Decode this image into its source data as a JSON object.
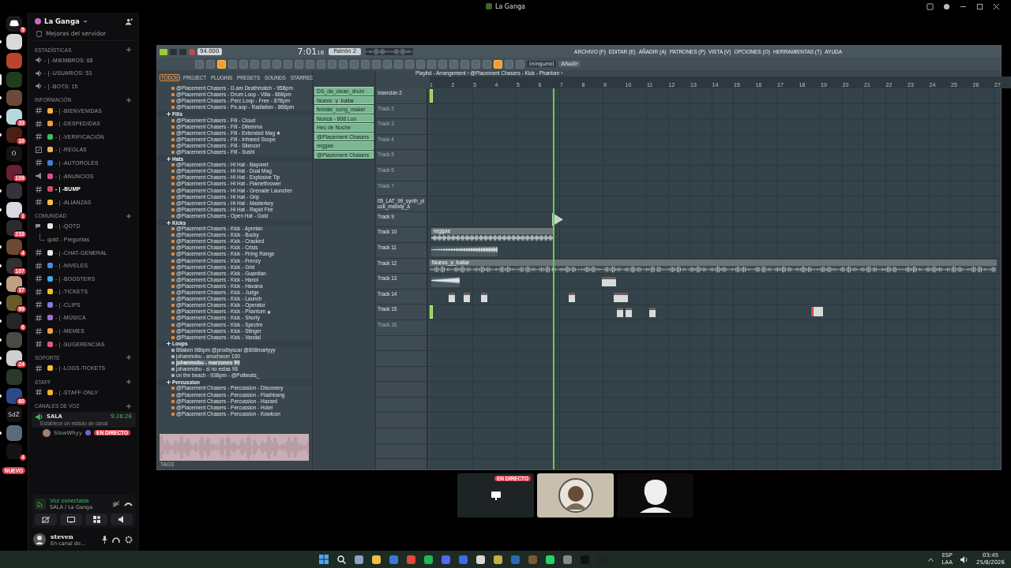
{
  "window": {
    "title": "La Ganga"
  },
  "servers": [
    {
      "kind": "home",
      "badge": "5",
      "selected": false,
      "unread": false
    },
    {
      "kind": "server",
      "color": "#d9d9d9",
      "selected": false,
      "unread": true
    },
    {
      "kind": "server",
      "color": "#b8442c",
      "selected": false,
      "unread": false
    },
    {
      "kind": "server",
      "color": "#1f3d1c",
      "selected": true,
      "unread": false
    },
    {
      "kind": "server",
      "color": "#6b4a3a",
      "selected": false,
      "unread": true
    },
    {
      "kind": "server",
      "color": "#b8d8e0",
      "badge": "33",
      "selected": false,
      "unread": true
    },
    {
      "kind": "server",
      "color": "#4a1f14",
      "badge": "10",
      "selected": false,
      "unread": true
    },
    {
      "kind": "text",
      "label": "O",
      "selected": false,
      "unread": false
    },
    {
      "kind": "server",
      "color": "#6a1f33",
      "badge": "109",
      "selected": false,
      "unread": false
    },
    {
      "kind": "server",
      "color": "#333338",
      "selected": false,
      "unread": true
    },
    {
      "kind": "server",
      "color": "#d8d8e0",
      "badge": "1",
      "selected": false,
      "unread": true
    },
    {
      "kind": "server",
      "color": "#2c2c2c",
      "badge": "233",
      "selected": false,
      "unread": false
    },
    {
      "kind": "server",
      "color": "#6a4a32",
      "badge": "4",
      "selected": false,
      "unread": true
    },
    {
      "kind": "server",
      "color": "#303030",
      "badge": "107",
      "selected": false,
      "unread": true
    },
    {
      "kind": "server",
      "color": "#c0a080",
      "badge": "37",
      "selected": false,
      "unread": true
    },
    {
      "kind": "server",
      "color": "#6a5a2a",
      "badge": "99",
      "selected": false,
      "unread": true
    },
    {
      "kind": "server",
      "color": "#262626",
      "badge": "6",
      "selected": false,
      "unread": true
    },
    {
      "kind": "server",
      "color": "#4a4a44",
      "selected": false,
      "unread": true
    },
    {
      "kind": "server",
      "color": "#cfcfcf",
      "badge": "24",
      "selected": false,
      "unread": true
    },
    {
      "kind": "server",
      "color": "#2a3a2a",
      "selected": false,
      "unread": false
    },
    {
      "kind": "server",
      "color": "#2a4a8a",
      "badge": "60",
      "selected": false,
      "unread": true
    },
    {
      "kind": "text",
      "label": "SdZ",
      "selected": false,
      "unread": false
    },
    {
      "kind": "server",
      "color": "#5a6a7a",
      "selected": false,
      "unread": true
    },
    {
      "kind": "server",
      "color": "#141414",
      "badge": "4",
      "selected": false,
      "unread": false
    },
    {
      "kind": "new",
      "label": "NUEVO",
      "selected": false,
      "unread": false
    }
  ],
  "server_header": {
    "name": "La Ganga",
    "boosts": "Mejoras del servidor"
  },
  "categories": [
    {
      "name": "ESTADÍSTICAS",
      "channels": [
        {
          "kind": "voice",
          "name": "- | -MIEMBROS: 68",
          "unread": false
        },
        {
          "kind": "voice",
          "name": "- | -USUARIOS: 53",
          "unread": false
        },
        {
          "kind": "voice",
          "name": "- | -BOTS: 15",
          "unread": false
        }
      ]
    },
    {
      "name": "INFORMACIÓN",
      "channels": [
        {
          "kind": "text",
          "color": "#f2b23a",
          "name": "- | -BIENVENIDAS",
          "unread": false
        },
        {
          "kind": "text",
          "color": "#f29a3a",
          "name": "- | -DESPEDIDAS",
          "unread": false
        },
        {
          "kind": "text",
          "color": "#3fbf5a",
          "name": "- | -VERIFICACIÓN",
          "unread": false
        },
        {
          "kind": "rules",
          "color": "#e8b060",
          "name": "- | -REGLAS",
          "unread": false
        },
        {
          "kind": "text",
          "color": "#4a7ad8",
          "name": "- | -AUTOROLES",
          "unread": false
        },
        {
          "kind": "announce",
          "color": "#e0508a",
          "name": "- | -ANUNCIOS",
          "unread": false
        },
        {
          "kind": "text",
          "color": "#d0506a",
          "name": "- | -BUMP",
          "unread": true
        },
        {
          "kind": "text",
          "color": "#f2c040",
          "name": "- | -ALIANZAS",
          "unread": false
        }
      ]
    },
    {
      "name": "COMUNIDAD",
      "channels": [
        {
          "kind": "forum",
          "color": "#e8e8e8",
          "name": "- | -QOTD",
          "unread": false
        },
        {
          "kind": "thread",
          "name": "qotd - Preguntas",
          "unread": false
        },
        {
          "kind": "text",
          "color": "#e8e8e8",
          "name": "- | -CHAT-GENERAL",
          "unread": false
        },
        {
          "kind": "text",
          "color": "#4a8ae0",
          "name": "- | -NIVELES",
          "unread": false
        },
        {
          "kind": "text",
          "color": "#40a8e8",
          "name": "- | -BOOSTERS",
          "unread": false
        },
        {
          "kind": "text",
          "color": "#f0c030",
          "name": "- | -TICKETS",
          "unread": false
        },
        {
          "kind": "text",
          "color": "#8a7ad0",
          "name": "- | -CLIPS",
          "unread": false
        },
        {
          "kind": "text",
          "color": "#9a70d8",
          "name": "- | -MÚSICA",
          "unread": false
        },
        {
          "kind": "text",
          "color": "#f0a040",
          "name": "- | -MEMES",
          "unread": false
        },
        {
          "kind": "text",
          "color": "#e05a7a",
          "name": "- | -SUGERENCIAS",
          "unread": false
        }
      ]
    },
    {
      "name": "SOPORTE",
      "channels": [
        {
          "kind": "text",
          "color": "#f0c040",
          "name": "- | -LOGS-TICKETS",
          "unread": false
        }
      ]
    },
    {
      "name": "STAFF",
      "channels": [
        {
          "kind": "text",
          "color": "#f0b030",
          "name": "- | -STAFF-ONLY",
          "unread": false
        }
      ]
    },
    {
      "name": "CANALES DE VOZ"
    }
  ],
  "voice_channel": {
    "name": "SALA",
    "timer": "9:28:26",
    "status_placeholder": "Establece un estado de canal",
    "member": "SlowWhyy",
    "live": "EN DIRECTO"
  },
  "voice_panel": {
    "status": "Voz conectada",
    "channel": "SALA / La Ganga"
  },
  "user_panel": {
    "name": "steven",
    "status": "En canal de..."
  },
  "fl": {
    "tempo": "94.000",
    "time": "7:01",
    "time_small": "18",
    "pattern": "Patrón 2",
    "menu": [
      "ARCHIVO (F)",
      "EDITAR (E)",
      "AÑADIR (A)",
      "PATRONES (P)",
      "VISTA (V)",
      "OPCIONES (O)",
      "HERRAMIENTAS (T)",
      "AYUDA"
    ],
    "tools": [
      {
        "selected": false
      },
      {
        "selected": false
      },
      {
        "selected": true
      },
      {
        "selected": false
      },
      {
        "selected": false
      },
      {
        "selected": false
      },
      {
        "selected": false
      },
      {
        "selected": false
      },
      {
        "selected": false
      },
      {
        "selected": false
      },
      {
        "selected": false
      },
      {
        "selected": false
      },
      {
        "selected": false
      },
      {
        "selected": false
      },
      {
        "selected": false
      },
      {
        "selected": false
      },
      {
        "selected": false
      },
      {
        "selected": false
      },
      {
        "selected": false
      },
      {
        "selected": false
      },
      {
        "selected": false
      },
      {
        "selected": false
      },
      {
        "selected": false
      },
      {
        "selected": false
      },
      {
        "selected": false
      },
      {
        "selected": false
      },
      {
        "selected": false
      },
      {
        "selected": true
      },
      {
        "selected": false
      },
      {
        "selected": false
      }
    ],
    "snap": "(ninguno)",
    "add": "Añadir",
    "browser_tabs": [
      {
        "label": "TODOS",
        "selected": true
      },
      {
        "label": "PROJECT",
        "selected": false
      },
      {
        "label": "PLUGINS",
        "selected": false
      },
      {
        "label": "PRESETS",
        "selected": false
      },
      {
        "label": "SOUNDS",
        "selected": false
      },
      {
        "label": "STARRED",
        "selected": false
      }
    ],
    "browser": [
      {
        "kind": "sample",
        "label": "@Placement Chasers - D.am Deathmatch - 95Bpm",
        "starred": false,
        "selected": false
      },
      {
        "kind": "sample",
        "label": "@Placement Chasers - Drum Loop - Villa - 86Bpm",
        "starred": false,
        "selected": false
      },
      {
        "kind": "sample",
        "label": "@Placement Chasers - Perc Loop - Free - 87Bpm",
        "starred": false,
        "selected": false
      },
      {
        "kind": "sample",
        "label": "@Placement Chasers - Pe.aop - Radiation - 86Bpm",
        "starred": false,
        "selected": false
      },
      {
        "kind": "folder",
        "label": "Fills",
        "children": [
          {
            "kind": "sample",
            "label": "@Placement Chasers - Fill - Cloud",
            "starred": false,
            "selected": false
          },
          {
            "kind": "sample",
            "label": "@Placement Chasers - Fill - Dilemma",
            "starred": false,
            "selected": false
          },
          {
            "kind": "sample",
            "label": "@Placement Chasers - Fill - Extended Mag",
            "starred": true,
            "selected": false
          },
          {
            "kind": "sample",
            "label": "@Placement Chasers - Fill - Infrared Scope",
            "starred": false,
            "selected": false
          },
          {
            "kind": "sample",
            "label": "@Placement Chasers - Fill - Silencer",
            "starred": false,
            "selected": false
          },
          {
            "kind": "sample",
            "label": "@Placement Chasers - Fill - Sushi",
            "starred": false,
            "selected": false
          }
        ]
      },
      {
        "kind": "folder",
        "label": "Hats",
        "children": [
          {
            "kind": "sample",
            "label": "@Placement Chasers - Hi Hat - Bayonet",
            "starred": false,
            "selected": false
          },
          {
            "kind": "sample",
            "label": "@Placement Chasers - Hi Hat - Dual Mag",
            "starred": false,
            "selected": false
          },
          {
            "kind": "sample",
            "label": "@Placement Chasers - Hi Hat - Explosive Tip",
            "starred": false,
            "selected": false
          },
          {
            "kind": "sample",
            "label": "@Placement Chasers - Hi Hat - Flamethrower",
            "starred": false,
            "selected": false
          },
          {
            "kind": "sample",
            "label": "@Placement Chasers - Hi Hat - Grenade Launcher",
            "starred": false,
            "selected": false
          },
          {
            "kind": "sample",
            "label": "@Placement Chasers - Hi Hat - Grip",
            "starred": false,
            "selected": false
          },
          {
            "kind": "sample",
            "label": "@Placement Chasers - Hi Hat - Masterkey",
            "starred": false,
            "selected": false
          },
          {
            "kind": "sample",
            "label": "@Placement Chasers - Hi Hat - Rapid Fire",
            "starred": false,
            "selected": false
          },
          {
            "kind": "sample",
            "label": "@Placement Chasers - Open Hat - Gold",
            "starred": false,
            "selected": false
          }
        ]
      },
      {
        "kind": "folder",
        "label": "Kicks",
        "children": [
          {
            "kind": "sample",
            "label": "@Placement Chasers - Kick - Apretan",
            "starred": false,
            "selected": false
          },
          {
            "kind": "sample",
            "label": "@Placement Chasers - Kick - Bucky",
            "starred": false,
            "selected": false
          },
          {
            "kind": "sample",
            "label": "@Placement Chasers - Kick - Cracked",
            "starred": false,
            "selected": false
          },
          {
            "kind": "sample",
            "label": "@Placement Chasers - Kick - Crisis",
            "starred": false,
            "selected": false
          },
          {
            "kind": "sample",
            "label": "@Placement Chasers - Kick - Firing Range",
            "starred": false,
            "selected": false
          },
          {
            "kind": "sample",
            "label": "@Placement Chasers - Kick - Frenzy",
            "starred": false,
            "selected": false
          },
          {
            "kind": "sample",
            "label": "@Placement Chasers - Kick - Grid",
            "starred": false,
            "selected": false
          },
          {
            "kind": "sample",
            "label": "@Placement Chasers - Kick - Guardian",
            "starred": false,
            "selected": false
          },
          {
            "kind": "sample",
            "label": "@Placement Chasers - Kick - Hanoi",
            "starred": false,
            "selected": false
          },
          {
            "kind": "sample",
            "label": "@Placement Chasers - Kick - Havana",
            "starred": false,
            "selected": false
          },
          {
            "kind": "sample",
            "label": "@Placement Chasers - Kick - Judge",
            "starred": false,
            "selected": false
          },
          {
            "kind": "sample",
            "label": "@Placement Chasers - Kick - Launch",
            "starred": false,
            "selected": false
          },
          {
            "kind": "sample",
            "label": "@Placement Chasers - Kick - Operator",
            "starred": false,
            "selected": false
          },
          {
            "kind": "sample",
            "label": "@Placement Chasers - Kick - Phantom",
            "starred": true,
            "selected": false
          },
          {
            "kind": "sample",
            "label": "@Placement Chasers - Kick - Shorty",
            "starred": false,
            "selected": false
          },
          {
            "kind": "sample",
            "label": "@Placement Chasers - Kick - Spectre",
            "starred": false,
            "selected": false
          },
          {
            "kind": "sample",
            "label": "@Placement Chasers - Kick - Stinger",
            "starred": false,
            "selected": false
          },
          {
            "kind": "sample",
            "label": "@Placement Chasers - Kick - Vandal",
            "starred": false,
            "selected": false
          }
        ]
      },
      {
        "kind": "folder",
        "label": "Loops",
        "children": [
          {
            "kind": "audio",
            "label": "Bilaken 96bpm @prodbyscar @808martyyy",
            "starred": false,
            "selected": false
          },
          {
            "kind": "audio",
            "label": "johanmobu - anochecer 100",
            "starred": false,
            "selected": false
          },
          {
            "kind": "audio",
            "label": "johanmobu - marzoneo 90",
            "starred": false,
            "selected": true
          },
          {
            "kind": "audio",
            "label": "johanmobu - si no estas 98",
            "starred": false,
            "selected": false
          },
          {
            "kind": "audio",
            "label": "on the beach - 93Bpm - @Polbeats_",
            "starred": false,
            "selected": false
          }
        ]
      },
      {
        "kind": "folder",
        "label": "Percussion",
        "children": [
          {
            "kind": "sample",
            "label": "@Placement Chasers - Percussion - Discovery",
            "starred": false,
            "selected": false
          },
          {
            "kind": "sample",
            "label": "@Placement Chasers - Percussion - Flashbang",
            "starred": false,
            "selected": false
          },
          {
            "kind": "sample",
            "label": "@Placement Chasers - Percussion - Hazard",
            "starred": false,
            "selected": false
          },
          {
            "kind": "sample",
            "label": "@Placement Chasers - Percussion - Hotel",
            "starred": false,
            "selected": false
          },
          {
            "kind": "sample",
            "label": "@Placement Chasers - Percussion - Kowloon",
            "starred": false,
            "selected": false
          }
        ]
      }
    ],
    "tags": "TAGS",
    "patterns": [
      "DS_da_clean_drum",
      "Nuevo_y_bailar",
      "female_song_maker",
      "Nunca - 808 Loo",
      "Hec de Noche",
      "@Placement Chasers",
      "reggae",
      "@Placement Chasers"
    ],
    "playlist_title": "Playlist - Arrangement › @Placement Chasers - Kick - Phantom ›",
    "ruler": [
      "1",
      "2",
      "3",
      "4",
      "5",
      "6",
      "7",
      "8",
      "9",
      "10",
      "11",
      "12",
      "13",
      "14",
      "15",
      "16",
      "17",
      "18",
      "19",
      "20",
      "21",
      "22",
      "23",
      "24",
      "25",
      "26",
      "27"
    ],
    "tracks": [
      {
        "name": "Inserción 2",
        "empty": false,
        "clips": [
          {
            "kind": "marker"
          }
        ]
      },
      {
        "name": "Track 2",
        "empty": true
      },
      {
        "name": "Track 3",
        "empty": true
      },
      {
        "name": "Track 4",
        "empty": true
      },
      {
        "name": "Track 5",
        "empty": true
      },
      {
        "name": "Track 6",
        "empty": true
      },
      {
        "name": "Track 7",
        "empty": true
      },
      {
        "name": "05_LAT_99_synth_pluck_melody_a",
        "empty": false
      },
      {
        "name": "Track 9",
        "empty": false,
        "clips": [
          {
            "kind": "hit"
          }
        ]
      },
      {
        "name": "Track 10",
        "empty": false,
        "clips": [
          {
            "kind": "audio",
            "label": "reggae"
          }
        ]
      },
      {
        "name": "Track 11",
        "empty": false,
        "clips": [
          {
            "kind": "swell"
          }
        ]
      },
      {
        "name": "Track 12",
        "empty": false,
        "clips": [
          {
            "kind": "audio",
            "label": "Nuevo_y_bailar"
          }
        ]
      },
      {
        "name": "Track 13",
        "empty": false,
        "clips": [
          {
            "kind": "swell"
          },
          {
            "kind": "pattern"
          }
        ]
      },
      {
        "name": "Track 14",
        "empty": false,
        "clips": [
          {
            "kind": "pattern"
          },
          {
            "kind": "pattern"
          },
          {
            "kind": "pattern"
          },
          {
            "kind": "pattern"
          },
          {
            "kind": "pattern"
          }
        ]
      },
      {
        "name": "Track 15",
        "empty": false,
        "clips": [
          {
            "kind": "marker"
          },
          {
            "kind": "pattern"
          },
          {
            "kind": "pattern"
          },
          {
            "kind": "pattern"
          },
          {
            "kind": "red"
          }
        ]
      },
      {
        "name": "Track 16",
        "empty": true
      }
    ]
  },
  "tiles": [
    {
      "kind": "screen",
      "live": "EN DIRECTO"
    },
    {
      "kind": "camera"
    },
    {
      "kind": "avatar"
    }
  ],
  "taskbar": {
    "lang": "ESP",
    "layout": "LAA",
    "time": "03:45",
    "date": "25/8/2026"
  }
}
